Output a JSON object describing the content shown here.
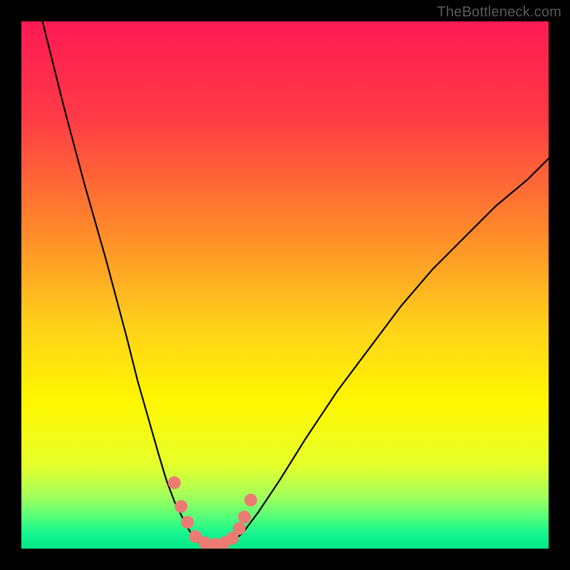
{
  "watermark": "TheBottleneck.com",
  "chart_data": {
    "type": "line",
    "title": "",
    "xlabel": "",
    "ylabel": "",
    "xlim": [
      0,
      100
    ],
    "ylim": [
      0,
      100
    ],
    "background_gradient_stops": [
      {
        "pos": 0.0,
        "color": "#ff1a54"
      },
      {
        "pos": 0.18,
        "color": "#ff3a46"
      },
      {
        "pos": 0.4,
        "color": "#ff8a2a"
      },
      {
        "pos": 0.58,
        "color": "#ffd21a"
      },
      {
        "pos": 0.72,
        "color": "#fff600"
      },
      {
        "pos": 0.84,
        "color": "#e6ff2a"
      },
      {
        "pos": 0.9,
        "color": "#a4ff5a"
      },
      {
        "pos": 0.94,
        "color": "#55ff7a"
      },
      {
        "pos": 0.97,
        "color": "#18f68f"
      },
      {
        "pos": 1.0,
        "color": "#00e887"
      }
    ],
    "series": [
      {
        "name": "left-branch",
        "color": "#000000",
        "x": [
          4,
          8,
          12,
          16,
          20,
          22,
          24,
          26,
          27.5,
          29,
          30.5,
          31.5,
          32.5,
          33.5
        ],
        "y": [
          100,
          84,
          69,
          55,
          40,
          32,
          25,
          18,
          13,
          9,
          6,
          4,
          2.5,
          1.3
        ]
      },
      {
        "name": "right-branch",
        "color": "#000000",
        "x": [
          40,
          42,
          45,
          49,
          54,
          60,
          66,
          72,
          78,
          84,
          90,
          96,
          100
        ],
        "y": [
          1.3,
          3,
          7,
          13,
          21,
          30,
          38,
          46,
          53,
          59,
          65,
          70,
          74
        ]
      },
      {
        "name": "valley-floor",
        "color": "#000000",
        "x": [
          33.5,
          35,
          36.5,
          38,
          39.2,
          40
        ],
        "y": [
          1.3,
          0.9,
          0.7,
          0.7,
          0.9,
          1.3
        ]
      }
    ],
    "markers": {
      "name": "salmon-dots",
      "color": "#ed7b74",
      "radius_px": 9,
      "points_xy": [
        [
          29.0,
          12.5
        ],
        [
          30.3,
          8.0
        ],
        [
          31.5,
          5.0
        ],
        [
          33.0,
          2.3
        ],
        [
          34.8,
          1.1
        ],
        [
          36.7,
          0.8
        ],
        [
          38.5,
          1.1
        ],
        [
          40.0,
          2.0
        ],
        [
          41.3,
          3.8
        ],
        [
          42.3,
          6.0
        ],
        [
          43.5,
          9.2
        ]
      ]
    }
  }
}
